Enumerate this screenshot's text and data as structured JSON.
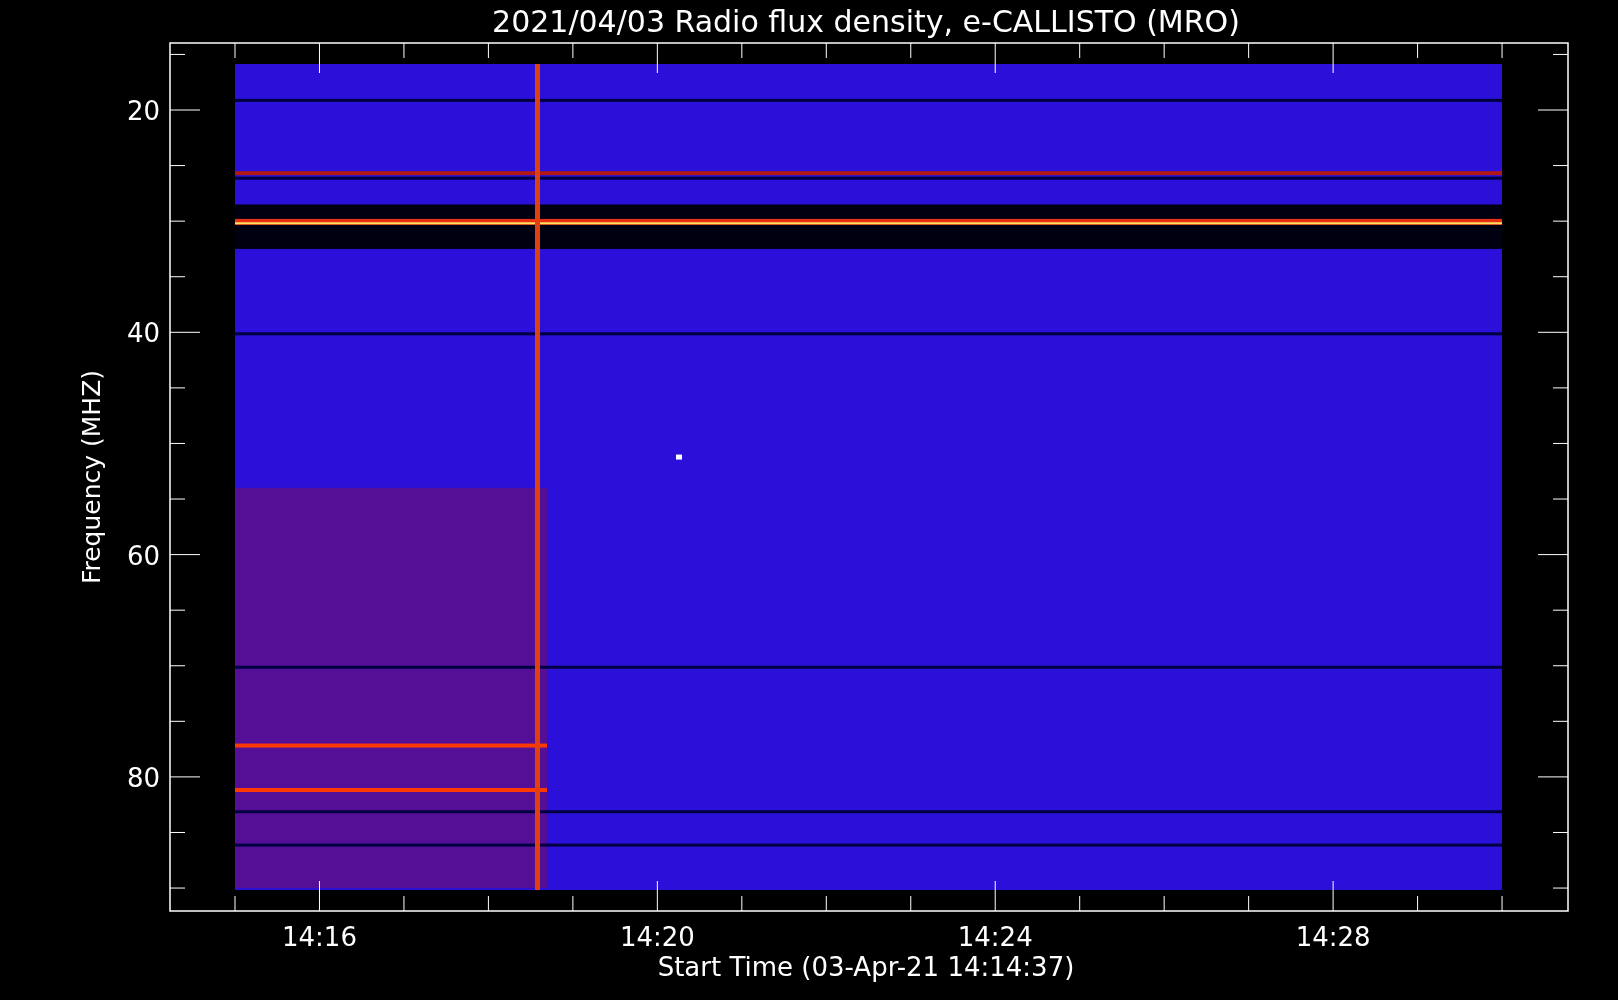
{
  "title": "2021/04/03  Radio flux density, e-CALLISTO (MRO)",
  "y_axis": {
    "label": "Frequency (MHZ)",
    "ticks": [
      "20",
      "40",
      "60",
      "80"
    ]
  },
  "x_axis": {
    "label": "Start Time (03-Apr-21 14:14:37)",
    "ticks": [
      "14:16",
      "14:20",
      "14:24",
      "14:28"
    ]
  }
}
